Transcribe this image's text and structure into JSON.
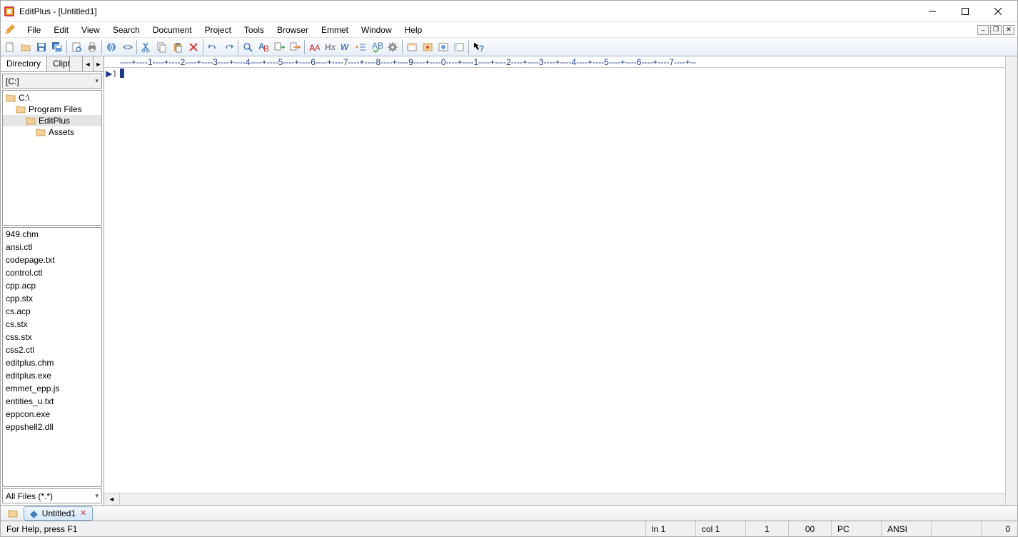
{
  "title": "EditPlus - [Untitled1]",
  "menu": [
    "File",
    "Edit",
    "View",
    "Search",
    "Document",
    "Project",
    "Tools",
    "Browser",
    "Emmet",
    "Window",
    "Help"
  ],
  "toolbar_groups": [
    [
      "new-file",
      "open-file",
      "save",
      "save-all"
    ],
    [
      "print-preview",
      "print"
    ],
    [
      "browser-preview",
      "html-toolbar"
    ],
    [
      "cut",
      "copy",
      "paste",
      "delete"
    ],
    [
      "undo",
      "redo"
    ],
    [
      "find",
      "find-replace",
      "goto",
      "goto-url"
    ],
    [
      "larger-font",
      "hex-view",
      "word-wrap",
      "indent",
      "spell-check",
      "prefs"
    ],
    [
      "window-list",
      "record-keys",
      "toggle-browser",
      "toggle-panel"
    ],
    [
      "help-arrow"
    ]
  ],
  "side_tabs": {
    "active": "Directory",
    "inactive": "Cliptext"
  },
  "drive": "[C:]",
  "folders": [
    {
      "name": "C:\\",
      "depth": 0,
      "selected": false
    },
    {
      "name": "Program Files",
      "depth": 1,
      "selected": false
    },
    {
      "name": "EditPlus",
      "depth": 2,
      "selected": true
    },
    {
      "name": "Assets",
      "depth": 3,
      "selected": false
    }
  ],
  "files": [
    "949.chm",
    "ansi.ctl",
    "codepage.txt",
    "control.ctl",
    "cpp.acp",
    "cpp.stx",
    "cs.acp",
    "cs.stx",
    "css.stx",
    "css2.ctl",
    "editplus.chm",
    "editplus.exe",
    "emmet_epp.js",
    "entities_u.txt",
    "eppcon.exe",
    "eppshell2.dll"
  ],
  "file_filter": "All Files (*.*)",
  "ruler": "----+----1----+----2----+----3----+----4----+----5----+----6----+----7----+----8----+----9----+----0----+----1----+----2----+----3----+----4----+----5----+----6----+----7----+--",
  "gutter_line": "1",
  "doc_tab": {
    "name": "Untitled1",
    "modified": true
  },
  "status": {
    "help": "For Help, press F1",
    "line": "ln 1",
    "col": "col 1",
    "sel": "1",
    "ovr": "00",
    "platform": "PC",
    "encoding": "ANSI",
    "zero": "0"
  }
}
